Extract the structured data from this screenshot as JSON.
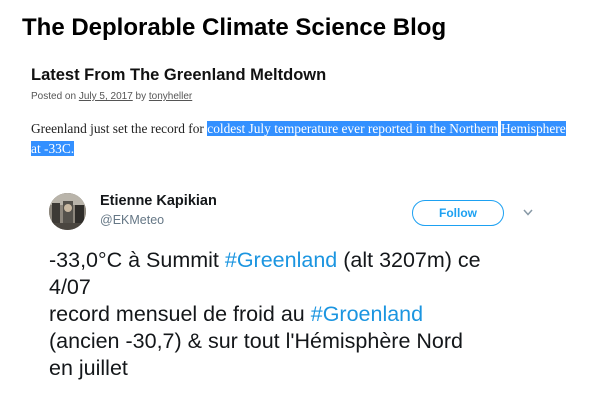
{
  "blog": {
    "title": "The Deplorable Climate Science Blog"
  },
  "post": {
    "title": "Latest From The Greenland Meltdown",
    "posted_on_label": "Posted on",
    "date": "July 5, 2017",
    "by_label": "by",
    "author": "tonyheller",
    "body_plain": "Greenland just set the record for ",
    "body_highlight_1": "coldest July temperature ever reported in the Northern",
    "body_highlight_2": "Hemisphere at -33C."
  },
  "tweet": {
    "name": "Etienne Kapikian",
    "handle": "@EKMeteo",
    "follow_label": "Follow",
    "line1_a": "-33,0°C à Summit ",
    "line1_tag": "#Greenland",
    "line1_b": " (alt 3207m) ce",
    "line2": "4/07",
    "line3_a": "record mensuel de froid au ",
    "line3_tag": "#Groenland",
    "line4": "(ancien -30,7) & sur tout l'Hémisphère Nord",
    "line5": "en juillet"
  },
  "colors": {
    "highlight": "#3390ff",
    "hashtag": "#1b95e0",
    "follow_accent": "#1da1f2",
    "handle_gray": "#657786"
  },
  "icons": {
    "avatar": "profile-photo",
    "more": "chevron-down-icon"
  }
}
